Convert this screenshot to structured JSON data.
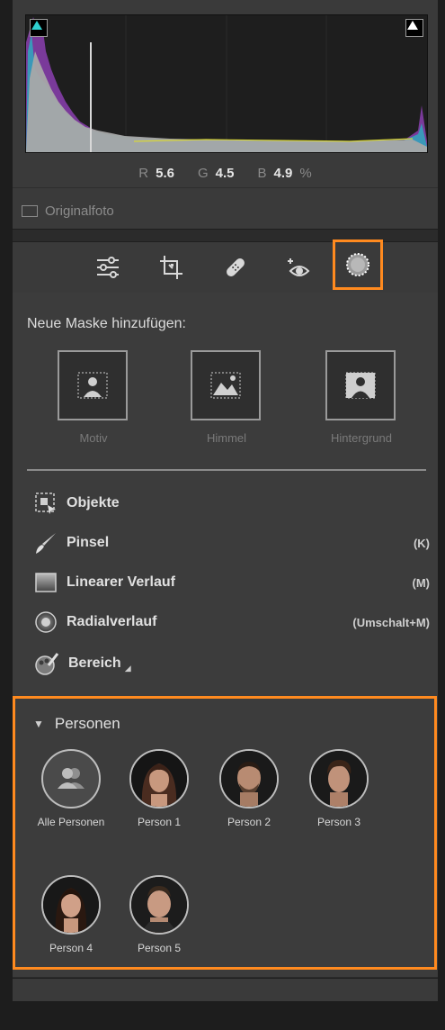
{
  "histogram": {
    "r_label": "R",
    "r_value": "5.6",
    "g_label": "G",
    "g_value": "4.5",
    "b_label": "B",
    "b_value": "4.9",
    "percent": "%",
    "original_photo_label": "Originalfoto"
  },
  "tools": [
    {
      "name": "edit-sliders-icon",
      "active": false
    },
    {
      "name": "crop-icon",
      "active": false
    },
    {
      "name": "healing-bandage-icon",
      "active": false
    },
    {
      "name": "red-eye-icon",
      "active": false
    },
    {
      "name": "masking-icon",
      "active": true
    }
  ],
  "masks": {
    "title": "Neue Maske hinzufügen:",
    "tiles": [
      {
        "label": "Motiv",
        "icon": "subject-icon"
      },
      {
        "label": "Himmel",
        "icon": "sky-icon"
      },
      {
        "label": "Hintergrund",
        "icon": "background-icon"
      }
    ],
    "tools": [
      {
        "label": "Objekte",
        "shortcut": "",
        "icon": "objects-icon"
      },
      {
        "label": "Pinsel",
        "shortcut": "(K)",
        "icon": "brush-icon"
      },
      {
        "label": "Linearer Verlauf",
        "shortcut": "(M)",
        "icon": "linear-gradient-icon"
      },
      {
        "label": "Radialverlauf",
        "shortcut": "(Umschalt+M)",
        "icon": "radial-gradient-icon"
      },
      {
        "label": "Bereich",
        "shortcut": "",
        "icon": "range-icon"
      }
    ]
  },
  "persons": {
    "title": "Personen",
    "items": [
      {
        "label": "Alle Personen",
        "icon": "all-people-icon"
      },
      {
        "label": "Person 1",
        "icon": "person-face-icon"
      },
      {
        "label": "Person 2",
        "icon": "person-face-icon"
      },
      {
        "label": "Person 3",
        "icon": "person-face-icon"
      },
      {
        "label": "Person 4",
        "icon": "person-face-icon"
      },
      {
        "label": "Person 5",
        "icon": "person-face-icon"
      }
    ]
  },
  "colors": {
    "accent": "#ff8a1f",
    "panel": "#3c3c3c",
    "frame": "#1d1d1d"
  }
}
